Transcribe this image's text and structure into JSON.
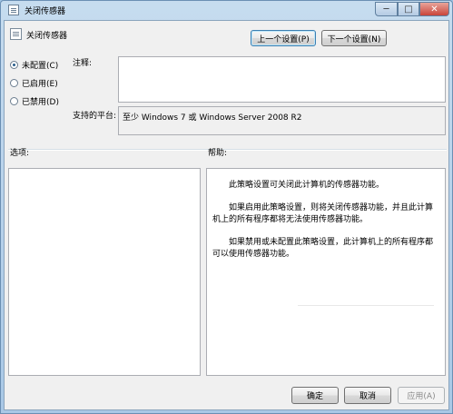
{
  "window": {
    "title": "关闭传感器",
    "min_glyph": "─",
    "max_glyph": "□",
    "close_glyph": "✕"
  },
  "header": {
    "title": "关闭传感器",
    "prev_button": "上一个设置(P)",
    "next_button": "下一个设置(N)"
  },
  "state_options": [
    {
      "label": "未配置(C)",
      "checked": true
    },
    {
      "label": "已启用(E)",
      "checked": false
    },
    {
      "label": "已禁用(D)",
      "checked": false
    }
  ],
  "comment": {
    "label": "注释:",
    "value": ""
  },
  "platform": {
    "label": "支持的平台:",
    "value": "至少 Windows 7 或 Windows Server 2008 R2"
  },
  "options_label": "选项:",
  "help_label": "帮助:",
  "help_paragraphs": [
    "此策略设置可关闭此计算机的传感器功能。",
    "如果启用此策略设置，则将关闭传感器功能，并且此计算机上的所有程序都将无法使用传感器功能。",
    "如果禁用或未配置此策略设置，此计算机上的所有程序都可以使用传感器功能。"
  ],
  "footer": {
    "ok": "确定",
    "cancel": "取消",
    "apply": "应用(A)"
  },
  "colors": {
    "frame": "#a9c8e6",
    "client": "#f0f0f0",
    "close_button": "#c9443a"
  }
}
